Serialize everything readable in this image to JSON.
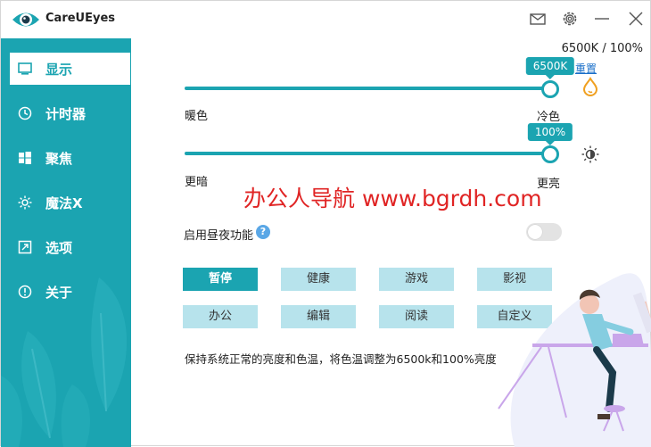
{
  "app": {
    "title": "CareUEyes",
    "accent_color": "#1ba4b1"
  },
  "titlebar_icons": [
    "mail-icon",
    "gear-icon",
    "minimize-icon",
    "close-icon"
  ],
  "sidebar": {
    "items": [
      {
        "label": "显示",
        "icon": "monitor-icon",
        "active": true
      },
      {
        "label": "计时器",
        "icon": "clock-icon",
        "active": false
      },
      {
        "label": "聚焦",
        "icon": "windows-icon",
        "active": false
      },
      {
        "label": "魔法X",
        "icon": "sun-icon",
        "active": false
      },
      {
        "label": "选项",
        "icon": "options-icon",
        "active": false
      },
      {
        "label": "关于",
        "icon": "info-icon",
        "active": false
      }
    ]
  },
  "main": {
    "status": "6500K / 100%",
    "reset_label": "重置",
    "color_temp": {
      "value_label": "6500K",
      "level": 1.0,
      "left_label": "暖色",
      "right_label": "冷色",
      "icon": "drop-icon"
    },
    "brightness": {
      "value_label": "100%",
      "level": 1.0,
      "left_label": "更暗",
      "right_label": "更亮",
      "icon": "brightness-icon"
    },
    "watermark": "办公人导航 www.bgrdh.com",
    "day_night": {
      "label": "启用昼夜功能",
      "help": "?",
      "enabled": false
    },
    "presets": [
      {
        "label": "暂停",
        "active": true
      },
      {
        "label": "健康",
        "active": false
      },
      {
        "label": "游戏",
        "active": false
      },
      {
        "label": "影视",
        "active": false
      },
      {
        "label": "办公",
        "active": false
      },
      {
        "label": "编辑",
        "active": false
      },
      {
        "label": "阅读",
        "active": false
      },
      {
        "label": "自定义",
        "active": false
      }
    ],
    "description": "保持系统正常的亮度和色温，将色温调整为6500k和100%亮度"
  }
}
